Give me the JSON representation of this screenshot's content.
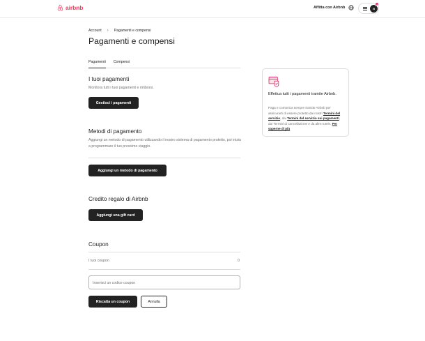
{
  "brand": {
    "name": "airbnb",
    "color": "#ff385c"
  },
  "header": {
    "host_link": "Affitta con Airbnb",
    "globe_icon": "globe-icon",
    "menu_icon": "hamburger-icon",
    "avatar_initials": "N",
    "notification_count": "1"
  },
  "breadcrumb": {
    "items": [
      "Account",
      "Pagamenti e compensi"
    ],
    "separator": "›"
  },
  "page_title": "Pagamenti e compensi",
  "tabs": [
    {
      "label": "Pagamenti",
      "active": true
    },
    {
      "label": "Compensi",
      "active": false
    }
  ],
  "payments": {
    "title": "I tuoi pagamenti",
    "description": "Monitora tutti i tuoi pagamenti e rimborsi.",
    "button": "Gestisci i pagamenti"
  },
  "methods": {
    "title": "Metodi di pagamento",
    "description": "Aggiungi un metodo di pagamento utilizzando il nostro sistema di pagamento protetto, poi inizia a programmare il tuo prossimo viaggio.",
    "button": "Aggiungi un metodo di pagamento"
  },
  "gift": {
    "title": "Credito regalo di Airbnb",
    "button": "Aggiungi una gift card"
  },
  "coupon": {
    "title": "Coupon",
    "row_label": "I tuoi coupon",
    "row_value": "0",
    "input_placeholder": "Inserisci un codice coupon",
    "redeem_button": "Riscatta un coupon",
    "cancel_button": "Annulla"
  },
  "side_card": {
    "icon": "secure-payment-icon",
    "title": "Effettua tutti i pagamenti tramite Airbnb.",
    "body_1": "Paga e comunica sempre tramite Airbnb per assicurarti di essere protetto dai nostri ",
    "link_terms": "Termini del servizio",
    "body_2": ", dai ",
    "link_payment_terms": "Termini del servizio sui pagamenti",
    "body_3": ", dai Termini di cancellazione e da altre tutele. ",
    "link_more": "Per saperne di più"
  }
}
